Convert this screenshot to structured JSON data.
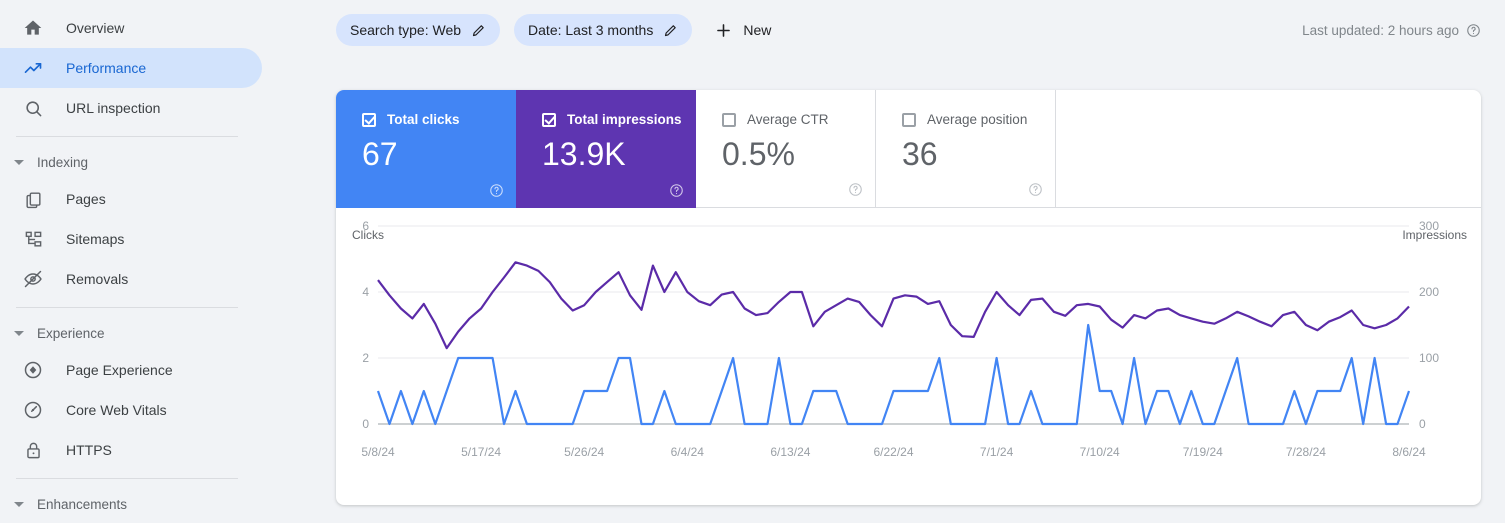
{
  "sidebar": {
    "items": [
      {
        "label": "Overview",
        "icon": "home-icon",
        "selected": false
      },
      {
        "label": "Performance",
        "icon": "trending-up-icon",
        "selected": true
      },
      {
        "label": "URL inspection",
        "icon": "search-icon",
        "selected": false
      }
    ],
    "groups": [
      {
        "label": "Indexing",
        "items": [
          {
            "label": "Pages",
            "icon": "pages-icon"
          },
          {
            "label": "Sitemaps",
            "icon": "sitemap-icon"
          },
          {
            "label": "Removals",
            "icon": "eye-off-icon"
          }
        ]
      },
      {
        "label": "Experience",
        "items": [
          {
            "label": "Page Experience",
            "icon": "diamond-icon"
          },
          {
            "label": "Core Web Vitals",
            "icon": "speedometer-icon"
          },
          {
            "label": "HTTPS",
            "icon": "lock-icon"
          }
        ]
      },
      {
        "label": "Enhancements",
        "items": []
      }
    ]
  },
  "filters": {
    "chips": [
      {
        "label": "Search type: Web",
        "icon": "pencil-icon"
      },
      {
        "label": "Date: Last 3 months",
        "icon": "pencil-icon"
      }
    ],
    "new_label": "New",
    "new_icon": "plus-icon",
    "last_updated": "Last updated: 2 hours ago",
    "last_updated_icon": "help-circle-icon"
  },
  "metrics": [
    {
      "title": "Total clicks",
      "value": "67",
      "checked": true,
      "color": "#4285f4",
      "help_icon": "help-circle-icon"
    },
    {
      "title": "Total impressions",
      "value": "13.9K",
      "checked": true,
      "color": "#5e35b1",
      "help_icon": "help-circle-icon"
    },
    {
      "title": "Average CTR",
      "value": "0.5%",
      "checked": false,
      "color": "#ffffff",
      "help_icon": "help-circle-icon"
    },
    {
      "title": "Average position",
      "value": "36",
      "checked": false,
      "color": "#ffffff",
      "help_icon": "help-circle-icon"
    }
  ],
  "chart_data": {
    "type": "line",
    "title": "",
    "xlabel": "",
    "ylabel": "Clicks",
    "y2label": "Impressions",
    "grid": true,
    "legend": "none",
    "ylim": [
      0,
      6
    ],
    "y2lim": [
      0,
      300
    ],
    "yticks": [
      "0",
      "2",
      "4",
      "6"
    ],
    "y2ticks": [
      "0",
      "100",
      "200",
      "300"
    ],
    "xticks": [
      "5/8/24",
      "5/17/24",
      "5/26/24",
      "6/4/24",
      "6/13/24",
      "6/22/24",
      "7/1/24",
      "7/10/24",
      "7/19/24",
      "7/28/24",
      "8/6/24"
    ],
    "x_start": "5/8/24",
    "x_end": "8/6/24",
    "n_points": 91,
    "series": [
      {
        "name": "Clicks",
        "color": "#4285f4",
        "axis": "left",
        "values": [
          1,
          0,
          1,
          0,
          1,
          0,
          1,
          2,
          2,
          2,
          2,
          0,
          1,
          0,
          0,
          0,
          0,
          0,
          1,
          1,
          1,
          2,
          2,
          0,
          0,
          1,
          0,
          0,
          0,
          0,
          1,
          2,
          0,
          0,
          0,
          2,
          0,
          0,
          1,
          1,
          1,
          0,
          0,
          0,
          0,
          1,
          1,
          1,
          1,
          2,
          0,
          0,
          0,
          0,
          2,
          0,
          0,
          1,
          0,
          0,
          0,
          0,
          3,
          1,
          1,
          0,
          2,
          0,
          1,
          1,
          0,
          1,
          0,
          0,
          1,
          2,
          0,
          0,
          0,
          0,
          1,
          0,
          1,
          1,
          1,
          2,
          0,
          2,
          0,
          0,
          1
        ]
      },
      {
        "name": "Impressions",
        "color": "#5b2ba8",
        "axis": "right",
        "values": [
          218,
          195,
          175,
          160,
          182,
          152,
          115,
          140,
          160,
          175,
          200,
          222,
          245,
          240,
          232,
          215,
          190,
          172,
          180,
          200,
          215,
          230,
          195,
          173,
          240,
          200,
          230,
          200,
          186,
          180,
          196,
          200,
          175,
          165,
          168,
          185,
          200,
          200,
          148,
          170,
          180,
          190,
          185,
          165,
          148,
          190,
          195,
          193,
          182,
          186,
          150,
          133,
          132,
          170,
          200,
          180,
          165,
          188,
          190,
          170,
          164,
          180,
          182,
          178,
          158,
          146,
          165,
          160,
          172,
          175,
          165,
          160,
          155,
          152,
          160,
          170,
          163,
          155,
          148,
          165,
          170,
          150,
          142,
          155,
          162,
          172,
          150,
          145,
          150,
          160,
          178
        ]
      }
    ]
  }
}
